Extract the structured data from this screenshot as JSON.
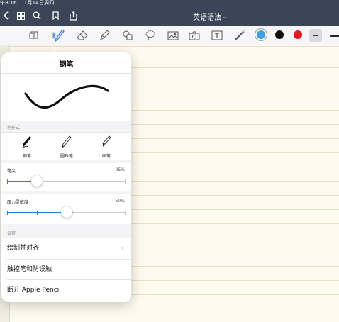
{
  "status_bar": {
    "time": "午8:16",
    "date": "1月14日周四"
  },
  "nav": {
    "doc_title": "英语语法",
    "title_chevron": "⌄"
  },
  "toolbar": {
    "colors": [
      "#3ea1e6",
      "#111111",
      "#e2191c"
    ]
  },
  "popover": {
    "title": "钢笔",
    "style_section_label": "笔样式",
    "pen_types": [
      {
        "label": "钢笔"
      },
      {
        "label": "圆珠笔"
      },
      {
        "label": "画笔"
      }
    ],
    "tip": {
      "label": "笔尖",
      "value": "25%",
      "level": 0.25
    },
    "pressure": {
      "label": "压力灵敏度",
      "value": "50%",
      "level": 0.5
    },
    "settings_label": "设置",
    "menu": [
      {
        "label": "绘制并对齐",
        "chevron": "›"
      },
      {
        "label": "触控笔和防误触"
      },
      {
        "label": "断开 Apple Pencil"
      }
    ]
  },
  "accent_color": "#2d7ed9"
}
